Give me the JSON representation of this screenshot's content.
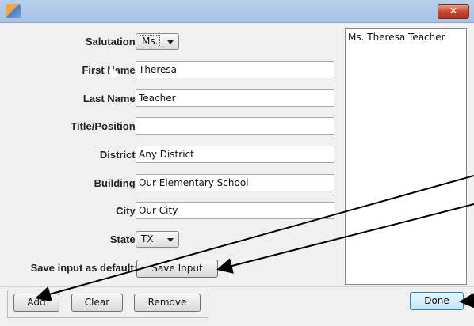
{
  "window": {
    "close_glyph": "✕"
  },
  "form": {
    "salutation": {
      "label": "Salutation:",
      "value": "Ms."
    },
    "first_name": {
      "label": "First Name:",
      "value": "Theresa"
    },
    "last_name": {
      "label": "Last Name:",
      "value": "Teacher"
    },
    "title_position": {
      "label": "Title/Position:",
      "value": ""
    },
    "district": {
      "label": "District:",
      "value": "Any District"
    },
    "building": {
      "label": "Building:",
      "value": "Our Elementary School"
    },
    "city": {
      "label": "City:",
      "value": "Our City"
    },
    "state": {
      "label": "State:",
      "value": "TX"
    },
    "save_default": {
      "label": "Save input as default:",
      "button": "Save Input"
    }
  },
  "list": {
    "items": [
      "Ms. Theresa Teacher"
    ]
  },
  "buttons": {
    "add": "Add",
    "clear": "Clear",
    "remove": "Remove",
    "done": "Done"
  },
  "colors": {
    "title_bar": "#a6c2e4",
    "close": "#c6442b",
    "arrow": "#000000"
  }
}
